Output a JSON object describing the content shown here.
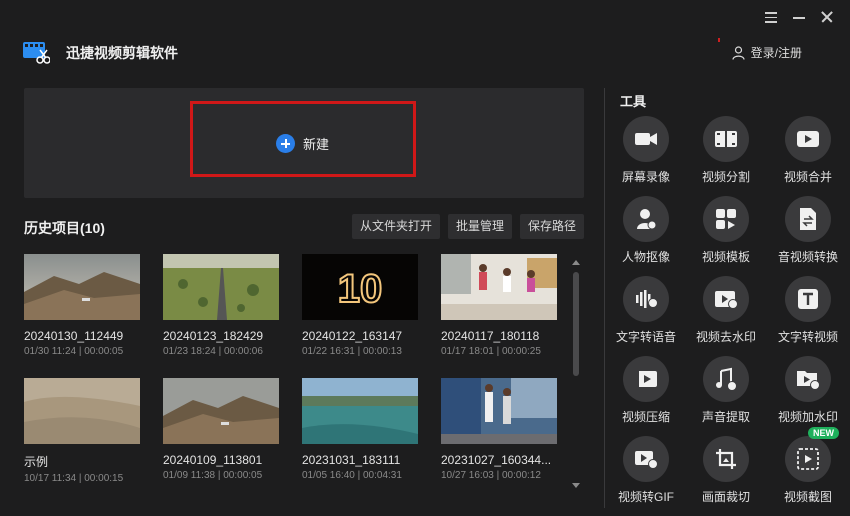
{
  "app": {
    "title": "迅捷视频剪辑软件"
  },
  "header": {
    "login_label": "登录/注册"
  },
  "new_project": {
    "label": "新建"
  },
  "history": {
    "title": "历史项目(10)",
    "actions": [
      "从文件夹打开",
      "批量管理",
      "保存路径"
    ],
    "items": [
      {
        "name": "20240130_112449",
        "meta": "01/30 11:24 | 00:00:05"
      },
      {
        "name": "20240123_182429",
        "meta": "01/23 18:24 | 00:00:06"
      },
      {
        "name": "20240122_163147",
        "meta": "01/22 16:31 | 00:00:13"
      },
      {
        "name": "20240117_180118",
        "meta": "01/17 18:01 | 00:00:25"
      },
      {
        "name": "示例",
        "meta": "10/17 11:34 | 00:00:15"
      },
      {
        "name": "20240109_113801",
        "meta": "01/09 11:38 | 00:00:05"
      },
      {
        "name": "20231031_183111",
        "meta": "01/05 16:40 | 00:04:31"
      },
      {
        "name": "20231027_160344...",
        "meta": "10/27 16:03 | 00:00:12"
      }
    ],
    "thumb_text_3": "10"
  },
  "tools": {
    "title": "工具",
    "items": [
      {
        "label": "屏幕录像",
        "icon": "camera-icon"
      },
      {
        "label": "视频分割",
        "icon": "film-split-icon"
      },
      {
        "label": "视频合并",
        "icon": "video-merge-icon"
      },
      {
        "label": "人物抠像",
        "icon": "portrait-cutout-icon"
      },
      {
        "label": "视频模板",
        "icon": "template-icon"
      },
      {
        "label": "音视频转换",
        "icon": "convert-icon"
      },
      {
        "label": "文字转语音",
        "icon": "text-to-speech-icon"
      },
      {
        "label": "视频去水印",
        "icon": "remove-watermark-icon"
      },
      {
        "label": "文字转视频",
        "icon": "text-to-video-icon"
      },
      {
        "label": "视频压缩",
        "icon": "compress-icon"
      },
      {
        "label": "声音提取",
        "icon": "audio-extract-icon"
      },
      {
        "label": "视频加水印",
        "icon": "add-watermark-icon"
      },
      {
        "label": "视频转GIF",
        "icon": "gif-icon"
      },
      {
        "label": "画面裁切",
        "icon": "crop-icon"
      },
      {
        "label": "视频截图",
        "icon": "screenshot-icon"
      }
    ],
    "new_badge": "NEW"
  },
  "colors": {
    "accent": "#2a7ee8",
    "highlight": "#d01818",
    "badge": "#1fb05c",
    "background": "#1d1d1e"
  }
}
